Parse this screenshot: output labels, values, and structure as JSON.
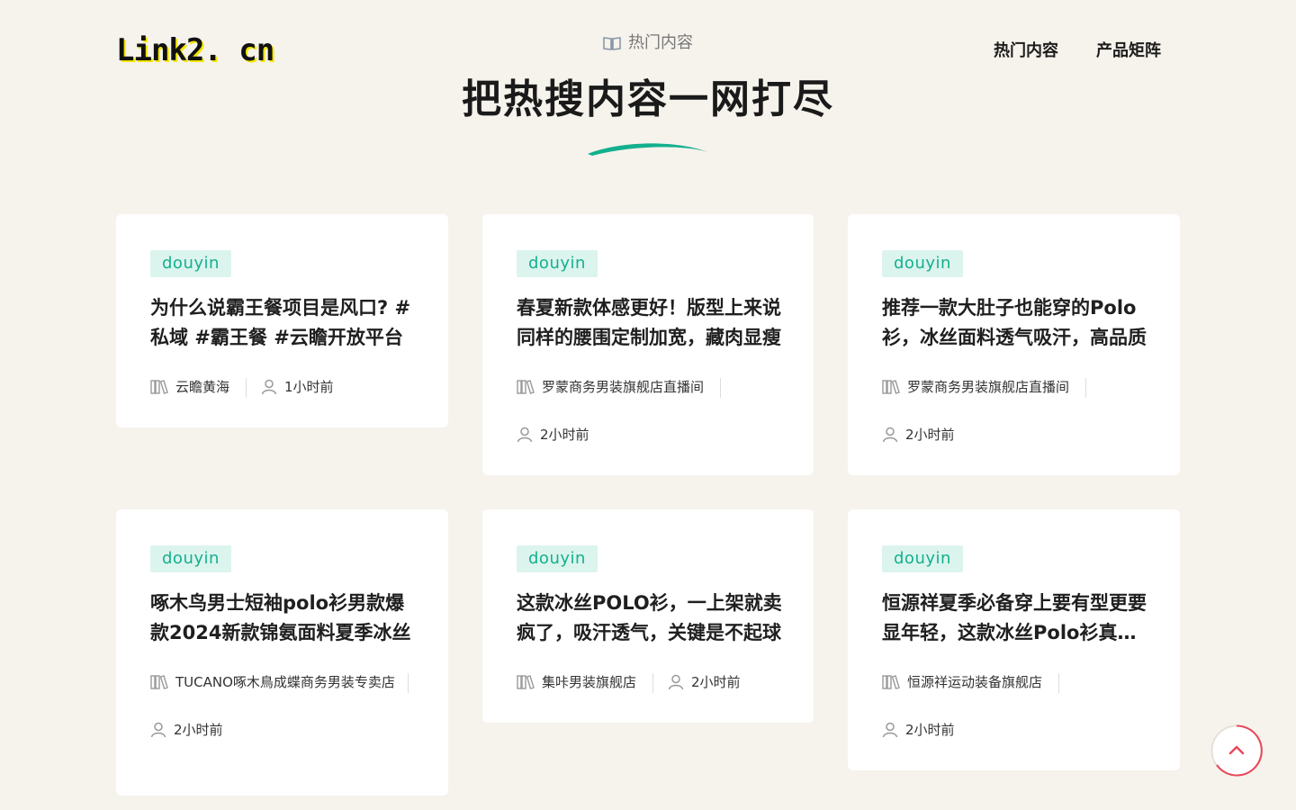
{
  "header": {
    "logo": "Link2. cn",
    "nav": [
      "热门内容",
      "产品矩阵"
    ]
  },
  "hero": {
    "kicker": "热门内容",
    "title": "把热搜内容一网打尽"
  },
  "colors": {
    "accent": "#13b08e",
    "tag_bg": "#dcf4ee",
    "logo_highlight": "#f2e600",
    "to_top": "#e8475a"
  },
  "cards": [
    {
      "tag": "douyin",
      "title": "为什么说霸王餐项目是风口? #私域 #霸王餐 #云瞻开放平台",
      "shop": "云瞻黄海",
      "time": "1小时前"
    },
    {
      "tag": "douyin",
      "title": "春夏新款体感更好！版型上来说同样的腰围定制加宽，藏肉显瘦",
      "shop": "罗蒙商务男装旗舰店直播间",
      "time": "2小时前"
    },
    {
      "tag": "douyin",
      "title": "推荐一款大肚子也能穿的Polo衫，冰丝面料透气吸汗，高品质",
      "shop": "罗蒙商务男装旗舰店直播间",
      "time": "2小时前"
    },
    {
      "tag": "douyin",
      "title": "啄木鸟男士短袖polo衫男款爆款2024新款锦氨面料夏季冰丝",
      "shop": "TUCANO啄木鳥成蝶商务男装专卖店",
      "time": "2小时前"
    },
    {
      "tag": "douyin",
      "title": "这款冰丝POLO衫，一上架就卖疯了，吸汗透气，关键是不起球",
      "shop": "集咔男装旗舰店",
      "time": "2小时前"
    },
    {
      "tag": "douyin",
      "title": "恒源祥夏季必备穿上要有型更要显年轻，这款冰丝Polo衫真的好",
      "shop": "恒源祥运动装备旗舰店",
      "time": "2小时前"
    }
  ]
}
